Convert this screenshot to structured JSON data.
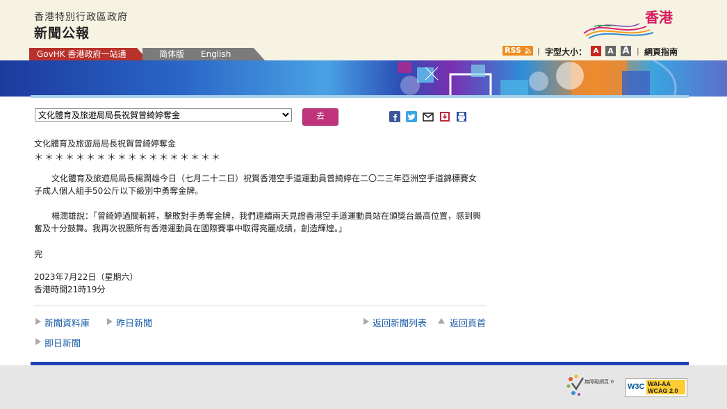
{
  "header": {
    "department": "香港特別行政區政府",
    "site_title": "新聞公報",
    "brand_text": "香港",
    "govhk_tab": "GovHK 香港政府一站通",
    "lang_simplified": "简体版",
    "lang_english": "English",
    "rss_label": "RSS",
    "font_size_label": "字型大小：",
    "font_size_small": "A",
    "font_size_medium": "A",
    "font_size_large": "A",
    "sitemap_label": "網頁指南"
  },
  "toolbar": {
    "topic_selected": "文化體育及旅遊局局長祝賀曾綺婷奪金",
    "go_label": "去"
  },
  "article": {
    "title": "文化體育及旅遊局局長祝賀曾綺婷奪金",
    "stars": "＊＊＊＊＊＊＊＊＊＊＊＊＊＊＊＊＊＊",
    "paragraph1": "文化體育及旅遊局局長楊潤雄今日（七月二十二日）祝賀香港空手道運動員曾綺婷在二〇二三年亞洲空手道錦標賽女子成人個人組手50公斤以下級別中勇奪金牌。",
    "paragraph2": "楊潤雄說：「曾綺婷過關斬將，擊敗對手勇奪金牌，我們連續兩天見證香港空手道運動員站在頒獎台最高位置，感到興奮及十分鼓舞。我再次祝願所有香港運動員在國際賽事中取得亮麗成績，創造輝煌。」",
    "end": "完",
    "date": "2023年7月22日（星期六）",
    "time": "香港時間21時19分"
  },
  "nav": {
    "archive": "新聞資料庫",
    "yesterday": "昨日新聞",
    "back_to_list": "返回新聞列表",
    "back_to_top": "返回頁首",
    "today": "即日新聞"
  },
  "footer": {
    "wfa_label": "無障礙網頁 Web For All",
    "wcag_label": "WAI-AA WCAG 2.0",
    "w3c_label": "W3C"
  },
  "colors": {
    "brand_pink": "#d71d5f",
    "govhk_red": "#b8322b",
    "go_button": "#c0337c",
    "link_blue": "#1a5ca8",
    "footer_blue": "#1e40b8"
  }
}
